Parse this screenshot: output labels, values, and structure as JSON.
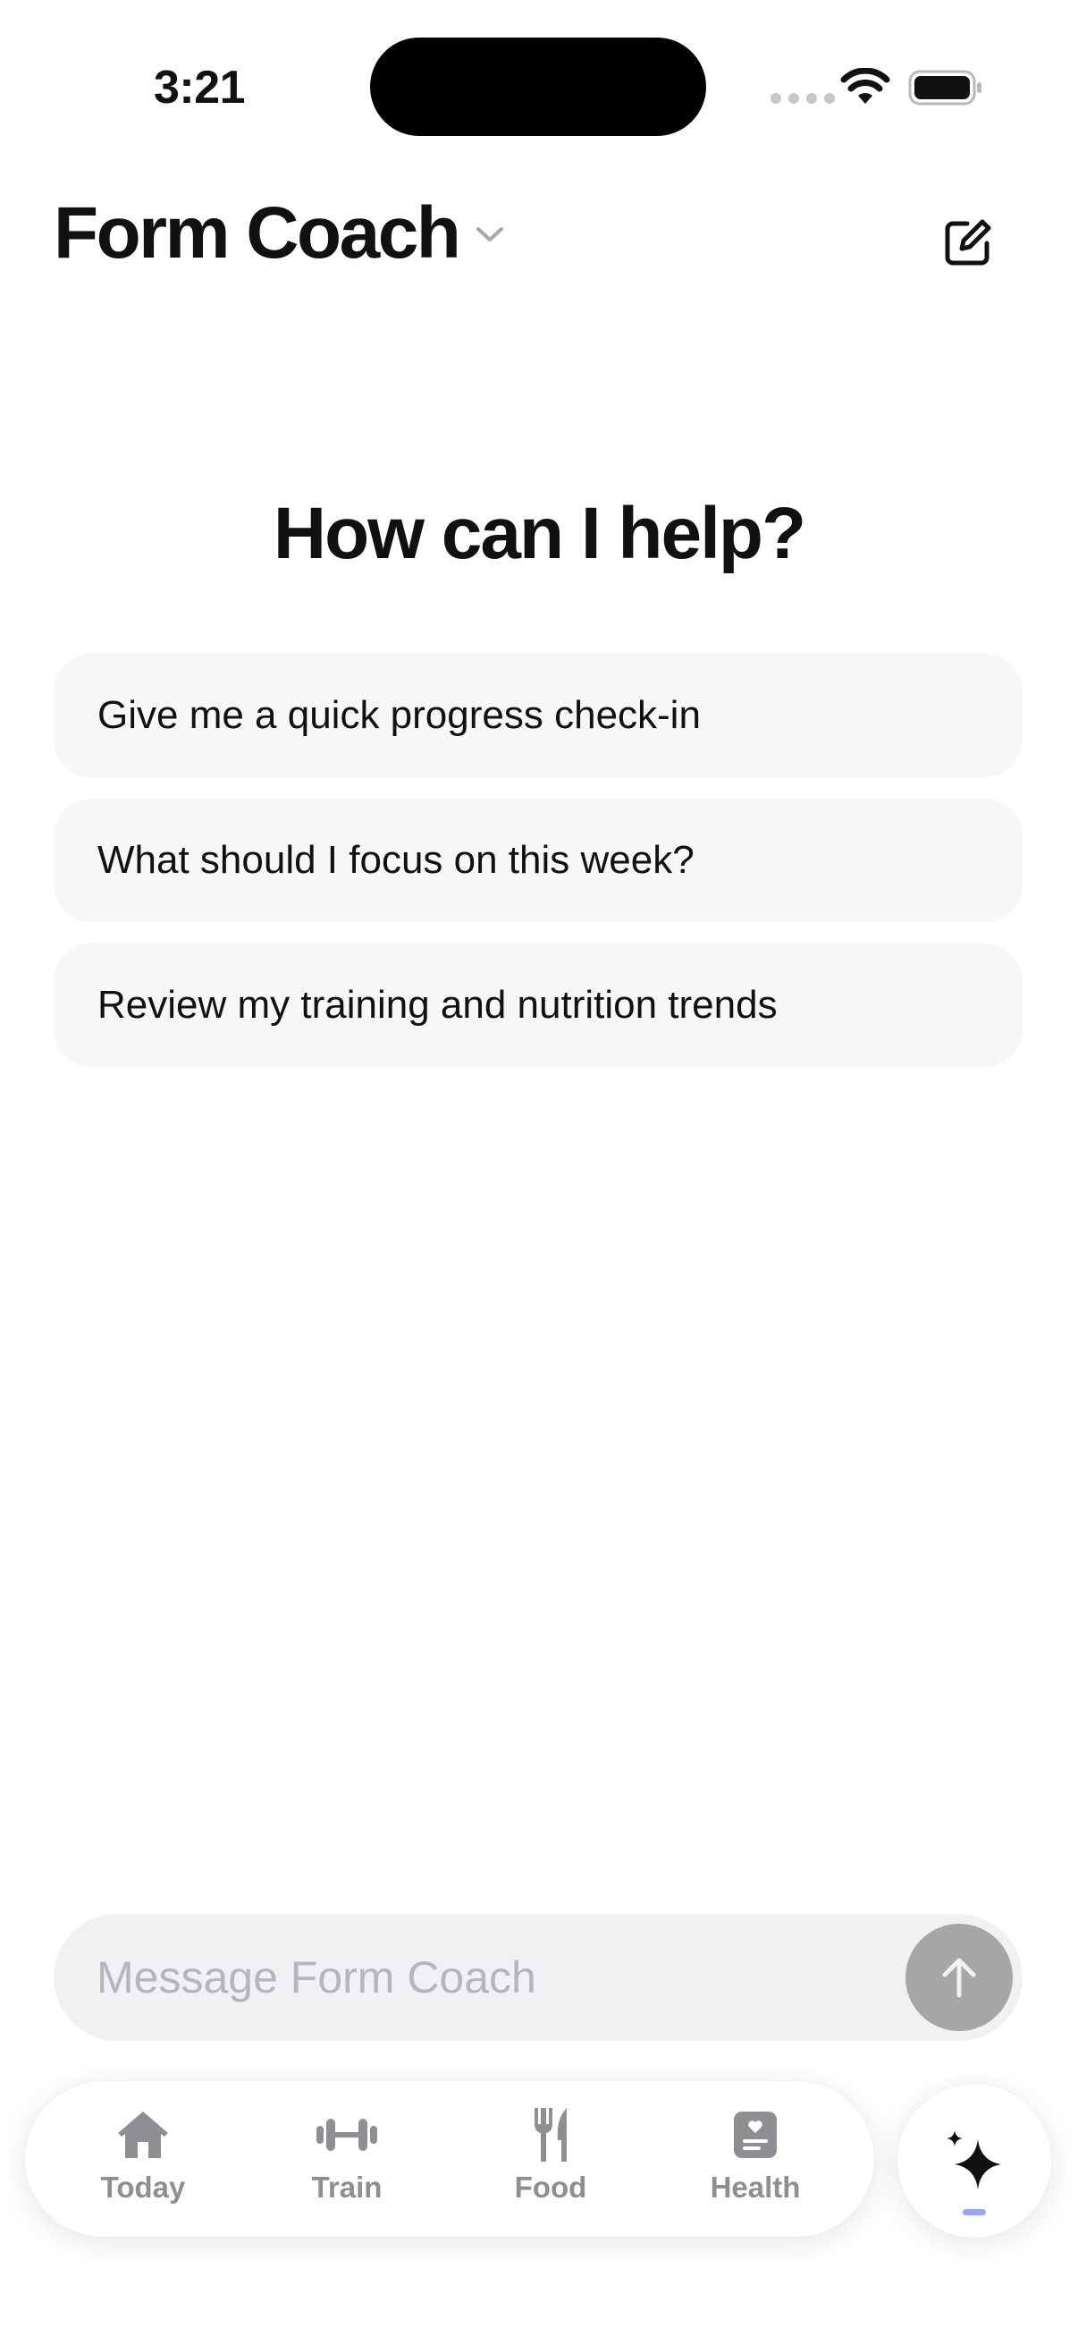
{
  "status_bar": {
    "time": "3:21",
    "icons": [
      "signal-dots-icon",
      "wifi-icon",
      "battery-icon"
    ]
  },
  "header": {
    "title": "Form Coach",
    "title_menu_icon": "chevron-down-icon",
    "compose_icon": "compose-icon"
  },
  "main": {
    "heading": "How can I help?",
    "suggestions": [
      {
        "label": "Give me a quick progress check-in"
      },
      {
        "label": "What should I focus on this week?"
      },
      {
        "label": "Review my training and nutrition trends"
      }
    ]
  },
  "composer": {
    "placeholder": "Message Form Coach",
    "value": "",
    "send_icon": "arrow-up-icon"
  },
  "tabbar": {
    "tabs": [
      {
        "label": "Today",
        "icon": "house-icon"
      },
      {
        "label": "Train",
        "icon": "dumbbell-icon"
      },
      {
        "label": "Food",
        "icon": "fork-knife-icon"
      },
      {
        "label": "Health",
        "icon": "health-record-icon"
      }
    ],
    "coach_tab": {
      "icon": "sparkle-icon",
      "active": true
    }
  },
  "colors": {
    "text": "#111111",
    "suggestion_bg": "#f7f7f8",
    "composer_bg": "#f0f1f3",
    "placeholder": "#b4b6bc",
    "send_button": "#a6a6a8",
    "tab_inactive": "#8e8e93",
    "active_indicator": "#9aa8f2"
  }
}
